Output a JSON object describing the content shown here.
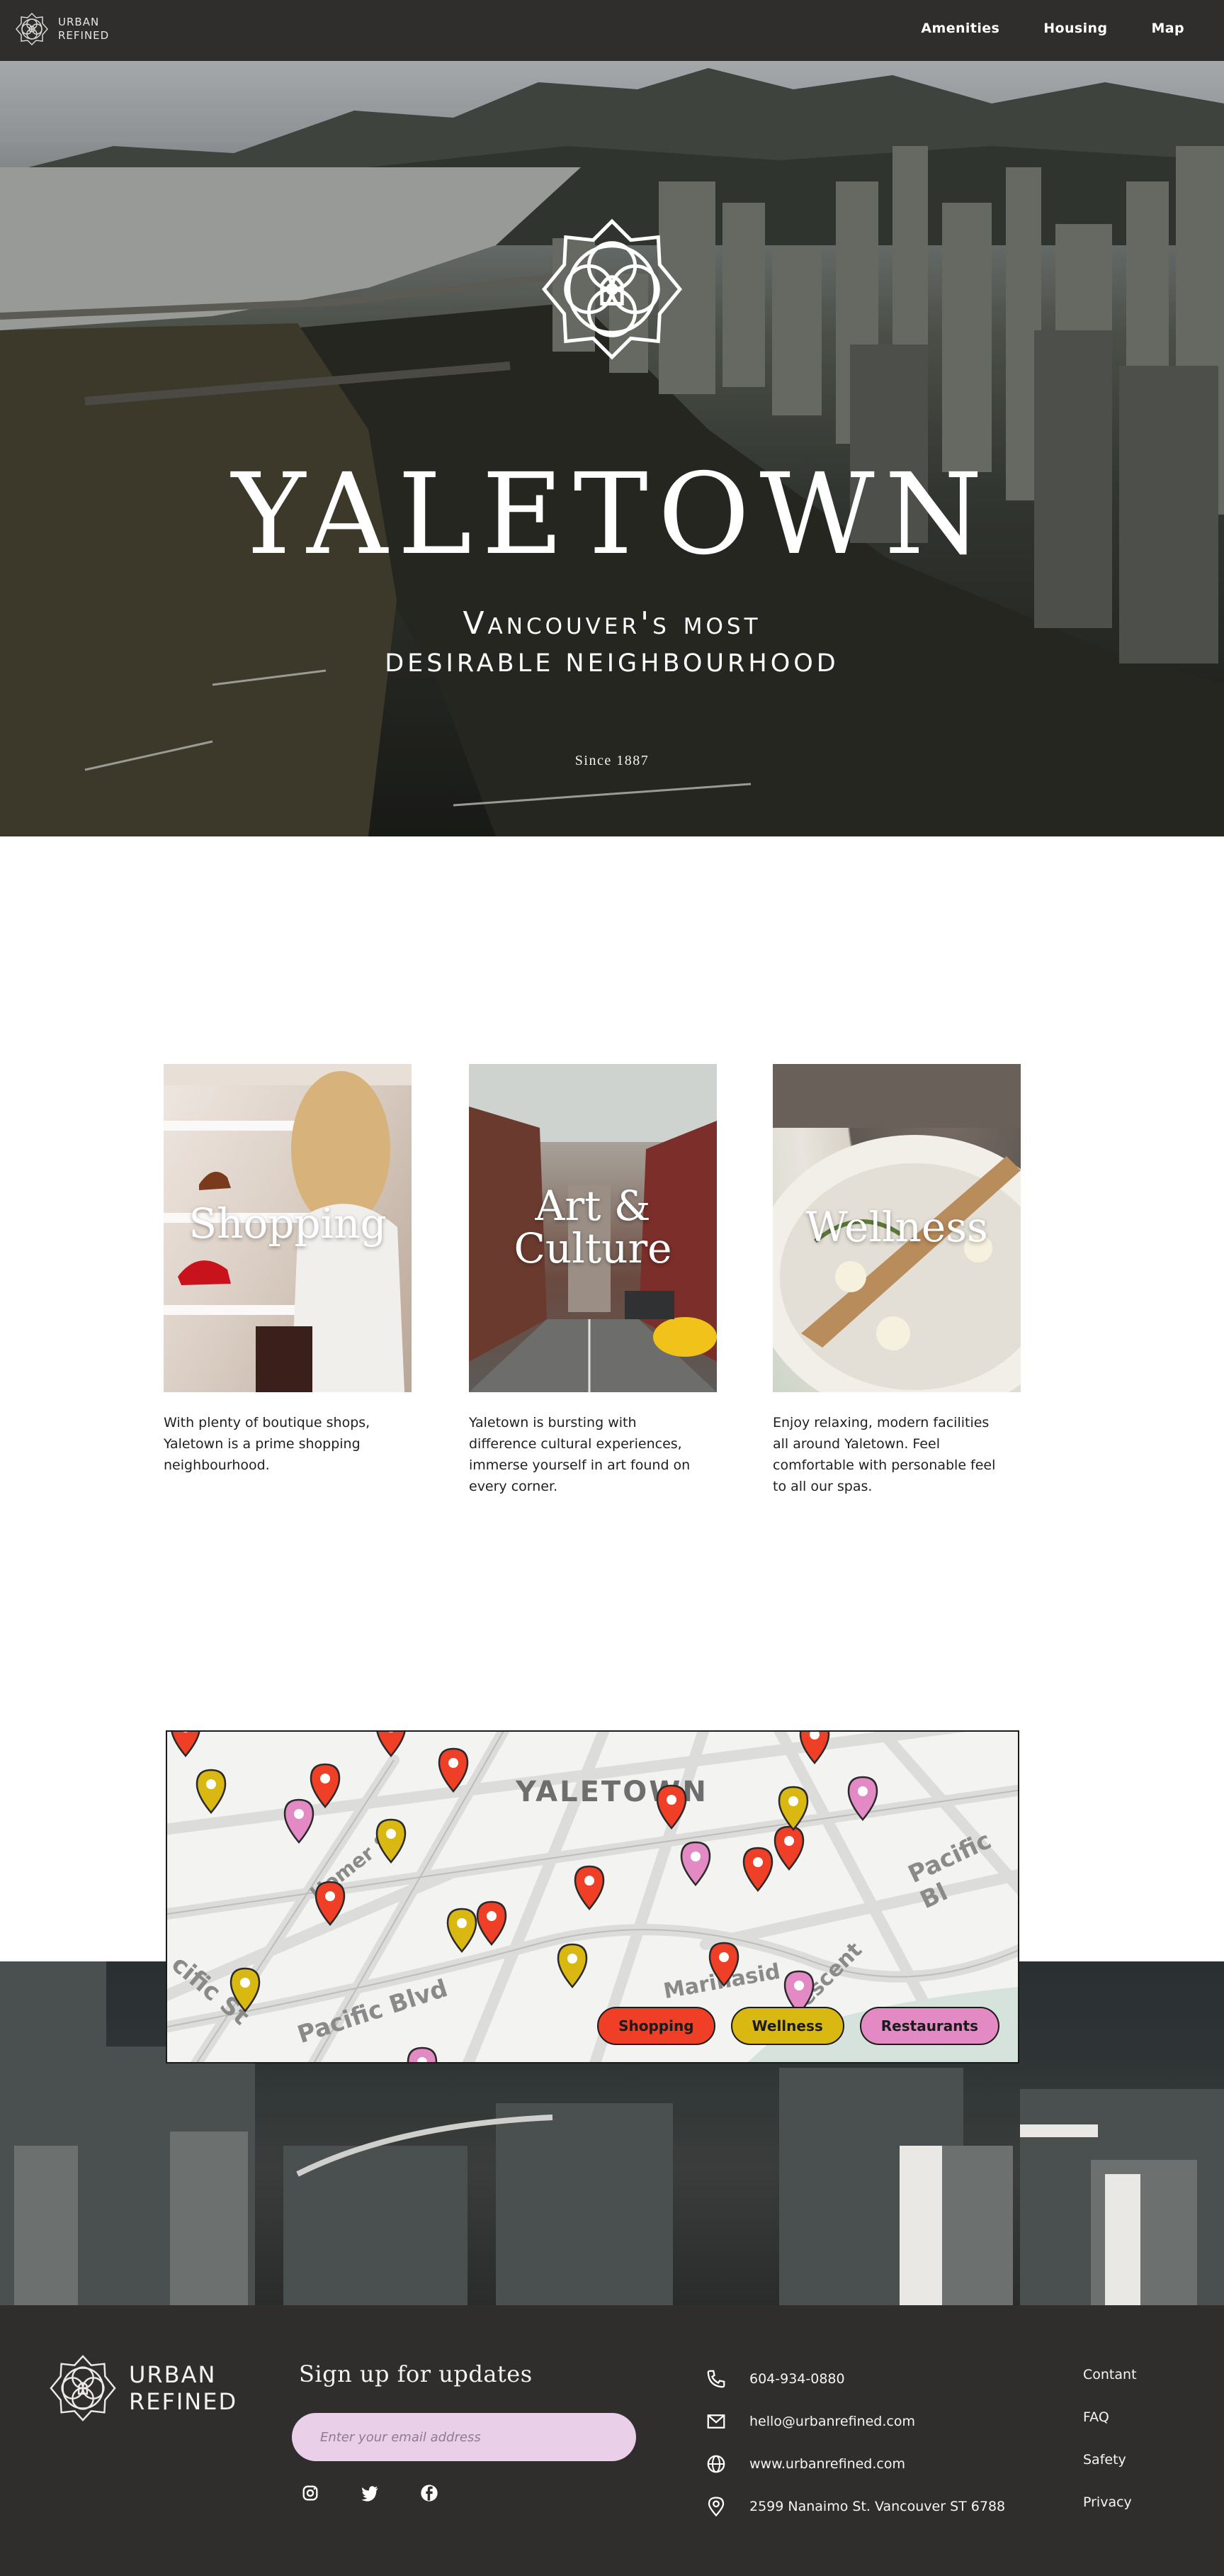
{
  "nav": {
    "brand_line1": "URBAN",
    "brand_line2": "REFINED",
    "links": [
      "Amenities",
      "Housing",
      "Map"
    ]
  },
  "hero": {
    "title": "YALETOWN",
    "subtitle_line1": "Vancouver's most",
    "subtitle_line2": "desirable neighbourhood",
    "since": "Since 1887"
  },
  "cards": [
    {
      "title": "Shopping",
      "text": "With plenty of boutique shops, Yaletown is a prime shopping neighbourhood."
    },
    {
      "title_line1": "Art &",
      "title_line2": "Culture",
      "text": "Yaletown is bursting with difference cultural experiences, immerse yourself in art found on every corner."
    },
    {
      "title": "Wellness",
      "text": "Enjoy relaxing, modern facilities all around Yaletown. Feel comfortable with personable feel to all our spas."
    }
  ],
  "map": {
    "labels": {
      "area": "YALETOWN",
      "homer": "Homer St",
      "pacific_blvd": "Pacific Blvd",
      "pacific_st": "cific St",
      "pacific_bl_right": "Pacific Bl",
      "marinaside": "Marinasid",
      "crescent": "escent"
    },
    "filters": [
      "Shopping",
      "Wellness",
      "Restaurants"
    ],
    "colors": {
      "shopping": "#ef3f27",
      "wellness": "#d9b812",
      "restaurants": "#e389c3"
    }
  },
  "footer": {
    "brand_line1": "URBAN",
    "brand_line2": "REFINED",
    "signup_title": "Sign up for updates",
    "email_placeholder": "Enter your email address",
    "social": [
      "instagram-icon",
      "twitter-icon",
      "facebook-icon"
    ],
    "contacts": {
      "phone": "604-934-0880",
      "email": "hello@urbanrefined.com",
      "web": "www.urbanrefined.com",
      "address": "2599 Nanaimo St. Vancouver ST 6788"
    },
    "links": [
      "Contant",
      "FAQ",
      "Safety",
      "Privacy"
    ]
  }
}
